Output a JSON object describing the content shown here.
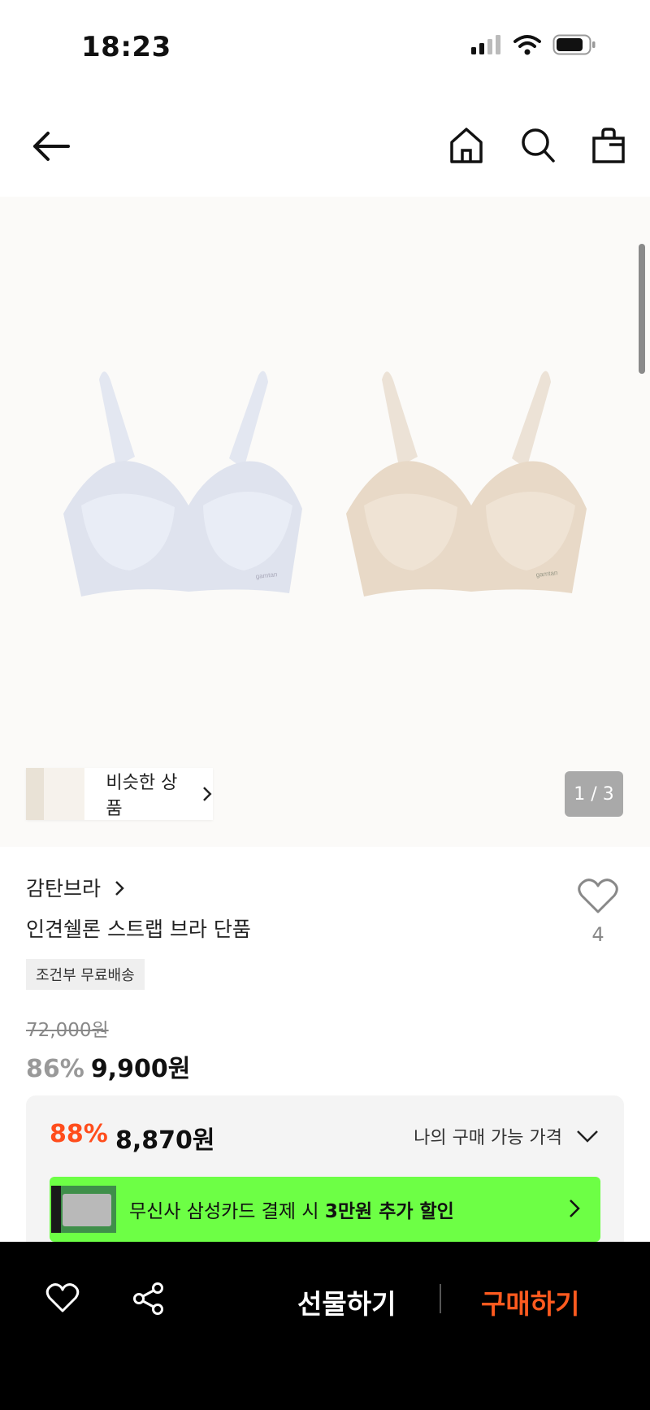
{
  "status": {
    "time": "18:23"
  },
  "header": {
    "icons": [
      "back-arrow-icon",
      "home-icon",
      "search-icon",
      "shopping-bag-icon"
    ]
  },
  "hero": {
    "similar_label": "비슷한 상품",
    "page_indicator": "1 / 3",
    "product_logo": "gamtan"
  },
  "product": {
    "brand": "감탄브라",
    "name": "인견쉘론 스트랩 브라 단품",
    "like_count": "4",
    "shipping_badge": "조건부 무료배송",
    "original_price": "72,000원",
    "discount_percent": "86%",
    "sale_price": "9,900원"
  },
  "my_price": {
    "discount_percent": "88%",
    "price": "8,870원",
    "toggle_label": "나의 구매 가능 가격"
  },
  "promo": {
    "text_prefix": "무신사 삼성카드 결제 시 ",
    "text_bold": "3만원 추가 할인",
    "accent": "#6dff45"
  },
  "bottom_bar": {
    "gift_label": "선물하기",
    "buy_label": "구매하기",
    "buy_color": "#ff5a1f"
  }
}
